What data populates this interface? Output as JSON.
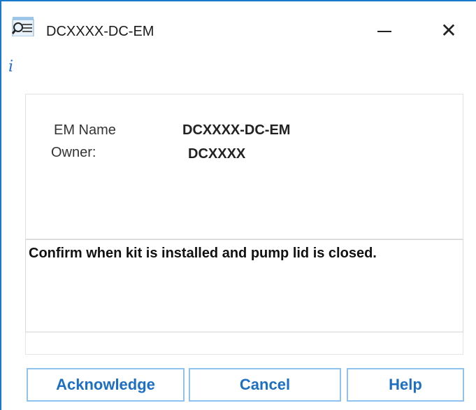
{
  "window": {
    "title": "DCXXXX-DC-EM",
    "icon": "search-document-icon",
    "minimize_icon": "minimize-icon",
    "close_icon": "close-icon",
    "close_glyph": "✕"
  },
  "info": {
    "icon_glyph": "i",
    "icon": "info-icon",
    "em_name_label": "EM Name",
    "em_name_value": "DCXXXX-DC-EM",
    "owner_label": "Owner:",
    "owner_value": "DCXXXX"
  },
  "message": "Confirm when kit is installed and pump lid is closed.",
  "buttons": {
    "acknowledge": "Acknowledge",
    "cancel": "Cancel",
    "help": "Help"
  },
  "colors": {
    "accent": "#1979ca",
    "button_text": "#1d6fc4",
    "button_border": "#8fc3ef"
  }
}
